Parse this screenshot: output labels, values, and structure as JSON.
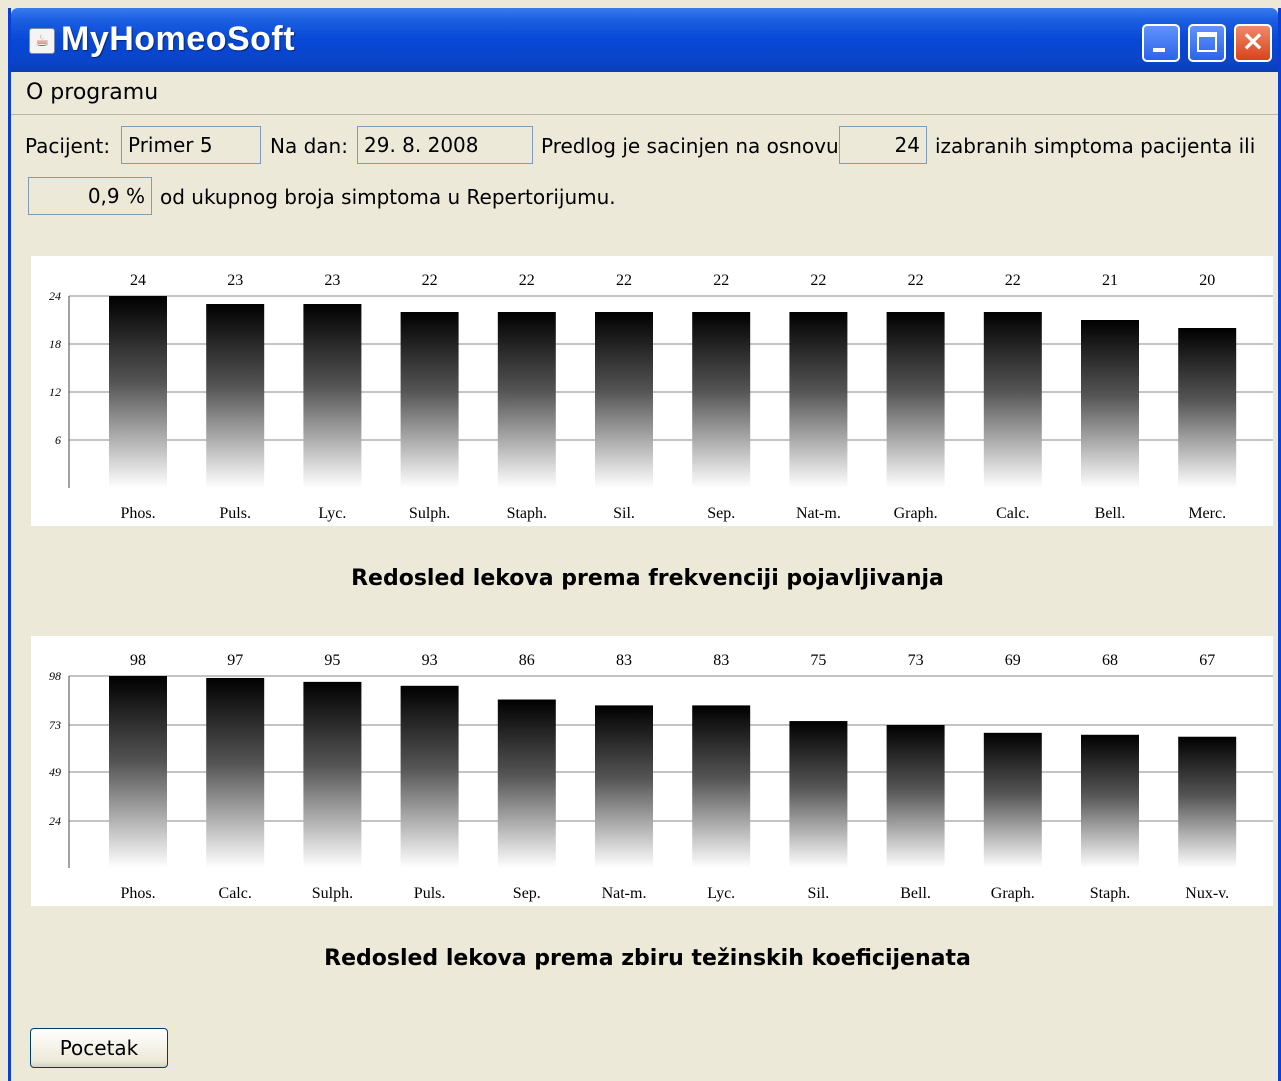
{
  "window": {
    "title": "MyHomeoSoft"
  },
  "menu": {
    "items": [
      "O programu"
    ]
  },
  "info": {
    "patient_label": "Pacijent:",
    "patient_value": "Primer 5",
    "date_label": "Na dan:",
    "date_value": "29. 8. 2008",
    "basis_text": "Predlog je sacinjen na osnovu",
    "symptom_count": "24",
    "symptom_text": "izabranih simptoma pacijenta ili",
    "percent_value": "0,9 %",
    "percent_text": "od ukupnog broja simptoma u Repertorijumu."
  },
  "chart_data": [
    {
      "type": "bar",
      "title": "Redosled lekova prema frekvenciji pojavljivanja",
      "categories": [
        "Phos.",
        "Puls.",
        "Lyc.",
        "Sulph.",
        "Staph.",
        "Sil.",
        "Sep.",
        "Nat-m.",
        "Graph.",
        "Calc.",
        "Bell.",
        "Merc."
      ],
      "values": [
        24,
        23,
        23,
        22,
        22,
        22,
        22,
        22,
        22,
        22,
        21,
        20
      ],
      "yticks": [
        24,
        18,
        12,
        6
      ],
      "ylim": [
        0,
        24
      ],
      "grid": true
    },
    {
      "type": "bar",
      "title": "Redosled lekova prema zbiru težinskih koeficijenata",
      "categories": [
        "Phos.",
        "Calc.",
        "Sulph.",
        "Puls.",
        "Sep.",
        "Nat-m.",
        "Lyc.",
        "Sil.",
        "Bell.",
        "Graph.",
        "Staph.",
        "Nux-v."
      ],
      "values": [
        98,
        97,
        95,
        93,
        86,
        83,
        83,
        75,
        73,
        69,
        68,
        67
      ],
      "yticks": [
        98,
        73,
        49,
        24
      ],
      "ylim": [
        0,
        98
      ],
      "grid": true
    }
  ],
  "footer": {
    "button_label": "Pocetak"
  }
}
